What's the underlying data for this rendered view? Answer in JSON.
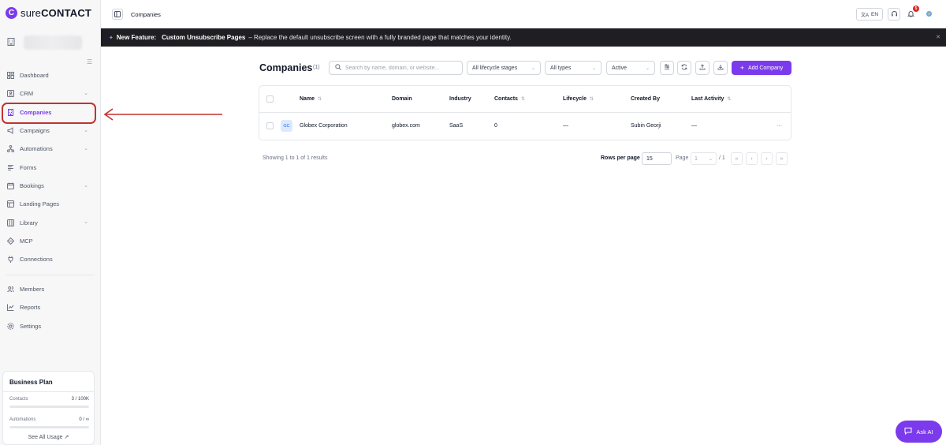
{
  "brand": {
    "name_light": "sure",
    "name_bold": "CONTACT",
    "logo_letter": "C"
  },
  "sidebar": {
    "items": [
      {
        "label": "Dashboard",
        "icon": "dashboard-icon",
        "chevron": false
      },
      {
        "label": "CRM",
        "icon": "crm-icon",
        "chevron": true
      },
      {
        "label": "Companies",
        "icon": "building-icon",
        "chevron": false,
        "active": true
      },
      {
        "label": "Campaigns",
        "icon": "megaphone-icon",
        "chevron": true
      },
      {
        "label": "Automations",
        "icon": "workflow-icon",
        "chevron": true
      },
      {
        "label": "Forms",
        "icon": "form-icon",
        "chevron": false
      },
      {
        "label": "Bookings",
        "icon": "calendar-icon",
        "chevron": true
      },
      {
        "label": "Landing Pages",
        "icon": "layout-icon",
        "chevron": false
      },
      {
        "label": "Library",
        "icon": "library-icon",
        "chevron": true
      },
      {
        "label": "MCP",
        "icon": "mcp-icon",
        "chevron": false
      },
      {
        "label": "Connections",
        "icon": "plug-icon",
        "chevron": false
      }
    ],
    "secondary": [
      {
        "label": "Members",
        "icon": "users-icon"
      },
      {
        "label": "Reports",
        "icon": "chart-icon"
      },
      {
        "label": "Settings",
        "icon": "gear-icon"
      }
    ],
    "plan": {
      "title": "Business Plan",
      "contacts_label": "Contacts",
      "contacts_value": "3 / 100K",
      "contacts_fraction": 3e-05,
      "automations_label": "Automations",
      "automations_value": "0 / ∞",
      "automations_fraction": 0,
      "see_all": "See All Usage ↗"
    }
  },
  "topbar": {
    "title": "Companies",
    "lang": "EN",
    "notification_count": "5"
  },
  "banner": {
    "prefix": "New Feature:",
    "feature": "Custom Unsubscribe Pages",
    "text": "– Replace the default unsubscribe screen with a fully branded page that matches your identity."
  },
  "main": {
    "title": "Companies",
    "count": "(1)",
    "search_placeholder": "Search by name, domain, or website...",
    "filters": {
      "lifecycle": "All lifecycle stages",
      "types": "All types",
      "status": "Active"
    },
    "add_button": "Add Company"
  },
  "table": {
    "headers": [
      "Name",
      "Domain",
      "Industry",
      "Contacts",
      "Lifecycle",
      "Created By",
      "Last Activity"
    ],
    "rows": [
      {
        "initials": "GC",
        "name": "Globex Corporation",
        "domain": "globex.com",
        "industry": "SaaS",
        "contacts": "0",
        "lifecycle": "—",
        "created_by": "Subin Georji",
        "last_activity": "—",
        "actions": "···"
      }
    ]
  },
  "pagination": {
    "showing": "Showing 1 to 1 of 1 results",
    "rows_per_page_label": "Rows per page",
    "rows_per_page": "15",
    "page_label": "Page",
    "page_value": "1",
    "page_total": "/ 1"
  },
  "ask_ai": "Ask AI",
  "colors": {
    "accent": "#7c3aed",
    "annotation": "#c2332e",
    "banner_bg": "#1f1f23"
  }
}
